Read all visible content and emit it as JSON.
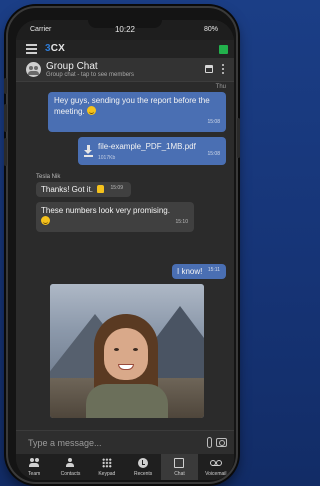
{
  "status_bar": {
    "carrier": "Carrier",
    "time": "10:22",
    "battery": "80%"
  },
  "app_bar": {
    "logo_prefix": "3",
    "logo_suffix": "CX",
    "presence_color": "#22b14c"
  },
  "chat_header": {
    "title": "Group Chat",
    "subtitle": "Group chat - tap to see members"
  },
  "messages": {
    "day_label": "Thu",
    "m1": {
      "text": "Hey guys, sending you the report before the meeting.",
      "time": "15:08"
    },
    "file": {
      "name": "file-example_PDF_1MB.pdf",
      "size": "1017Kb",
      "time": "15:08"
    },
    "sender": "Tesla Nik",
    "m2": {
      "text": "Thanks! Got it.",
      "time": "15:09"
    },
    "m3": {
      "text": "These numbers look very promising.",
      "time": "15:10"
    },
    "m4": {
      "text": "I know!",
      "time": "15:11"
    }
  },
  "input": {
    "placeholder": "Type a message..."
  },
  "nav": {
    "team": "Team",
    "contacts": "Contacts",
    "keypad": "Keypad",
    "recents": "Recents",
    "chat": "Chat",
    "voicemail": "Voicemail",
    "active": "Chat"
  },
  "colors": {
    "outgoing_bubble": "#4a6fb3",
    "incoming_bubble": "#404040",
    "background": "#1b3e86"
  }
}
